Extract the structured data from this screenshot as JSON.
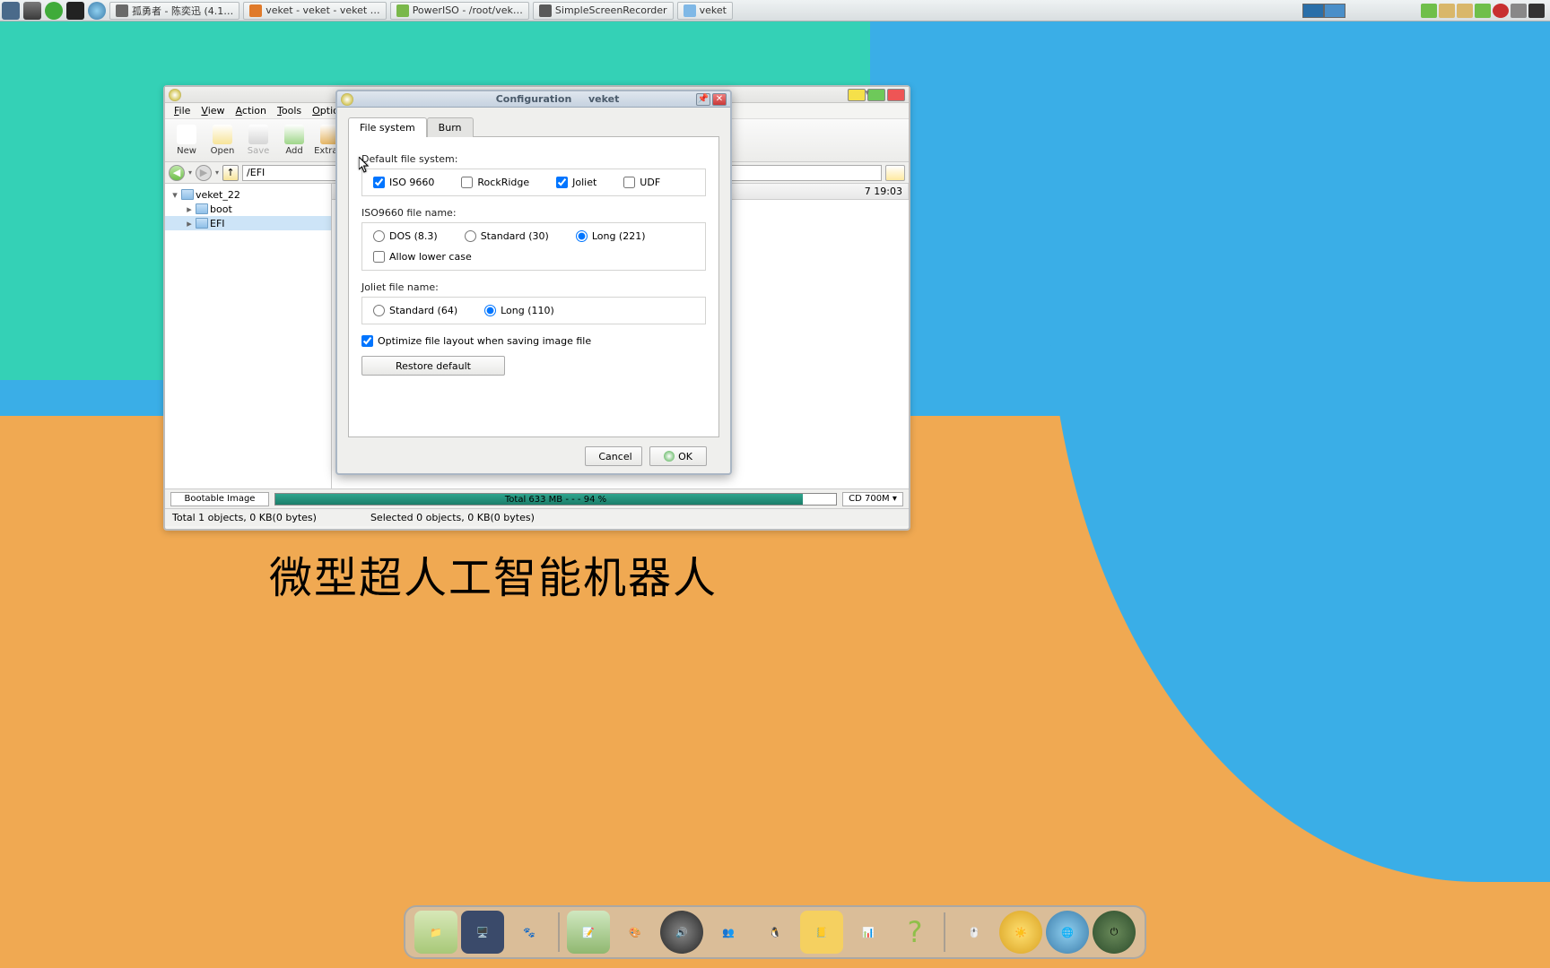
{
  "top_panel": {
    "tasks": [
      {
        "label": "孤勇者 - 陈奕迅 (4.1…",
        "name": "task-music",
        "ic": "#6a6a6a"
      },
      {
        "label": "veket - veket - veket …",
        "name": "task-firefox",
        "ic": "#e07a2a"
      },
      {
        "label": "PowerISO - /root/vek…",
        "name": "task-poweriso",
        "ic": "#7ab84a"
      },
      {
        "label": "SimpleScreenRecorder",
        "name": "task-ssr",
        "ic": "#5a5a5a"
      },
      {
        "label": "veket",
        "name": "task-filemgr",
        "ic": "#7fb8e6"
      }
    ]
  },
  "desktop_text": "微型超人工智能机器人",
  "main_window": {
    "menubar": [
      "File",
      "View",
      "Action",
      "Tools",
      "Options"
    ],
    "toolbar": [
      {
        "label": "New",
        "name": "btn-new",
        "color": "#fff",
        "dis": false
      },
      {
        "label": "Open",
        "name": "btn-open",
        "color": "#f7e49a",
        "dis": false
      },
      {
        "label": "Save",
        "name": "btn-save",
        "color": "#d6d6d6",
        "dis": true
      },
      {
        "label": "Add",
        "name": "btn-add",
        "color": "#9fd68a",
        "dis": false
      },
      {
        "label": "Extract",
        "name": "btn-extract",
        "color": "#e6b766",
        "dis": false
      }
    ],
    "path": "/EFI",
    "tree": [
      {
        "label": "veket_22",
        "indent": 0,
        "exp": "▾",
        "sel": false
      },
      {
        "label": "boot",
        "indent": 1,
        "exp": "▸",
        "sel": false
      },
      {
        "label": "EFI",
        "indent": 1,
        "exp": "▸",
        "sel": true
      }
    ],
    "list_header_date": "7 19:03",
    "status": {
      "bootable": "Bootable Image",
      "bar_text": "Total  633 MB   - - -   94 %",
      "cd": "CD 700M ▾",
      "left": "Total 1 objects, 0 KB(0 bytes)",
      "right": "Selected 0 objects, 0 KB(0 bytes)"
    }
  },
  "dialog": {
    "title": "Configuration",
    "app": "veket",
    "tabs": {
      "file_system": "File system",
      "burn": "Burn"
    },
    "default_fs_label": "Default file system:",
    "fs": [
      {
        "label": "ISO 9660",
        "checked": true
      },
      {
        "label": "RockRidge",
        "checked": false
      },
      {
        "label": "Joliet",
        "checked": true
      },
      {
        "label": "UDF",
        "checked": false
      }
    ],
    "iso_name_label": "ISO9660 file name:",
    "iso_name": [
      {
        "label": "DOS (8.3)",
        "sel": false
      },
      {
        "label": "Standard (30)",
        "sel": false
      },
      {
        "label": "Long (221)",
        "sel": true
      }
    ],
    "allow_lower": {
      "label": "Allow lower case",
      "checked": false
    },
    "joliet_name_label": "Joliet file name:",
    "joliet_name": [
      {
        "label": "Standard (64)",
        "sel": false
      },
      {
        "label": "Long (110)",
        "sel": true
      }
    ],
    "optimize": {
      "label": "Optimize file layout when saving image file",
      "checked": true
    },
    "restore": "Restore default",
    "cancel": "Cancel",
    "ok": "OK"
  }
}
